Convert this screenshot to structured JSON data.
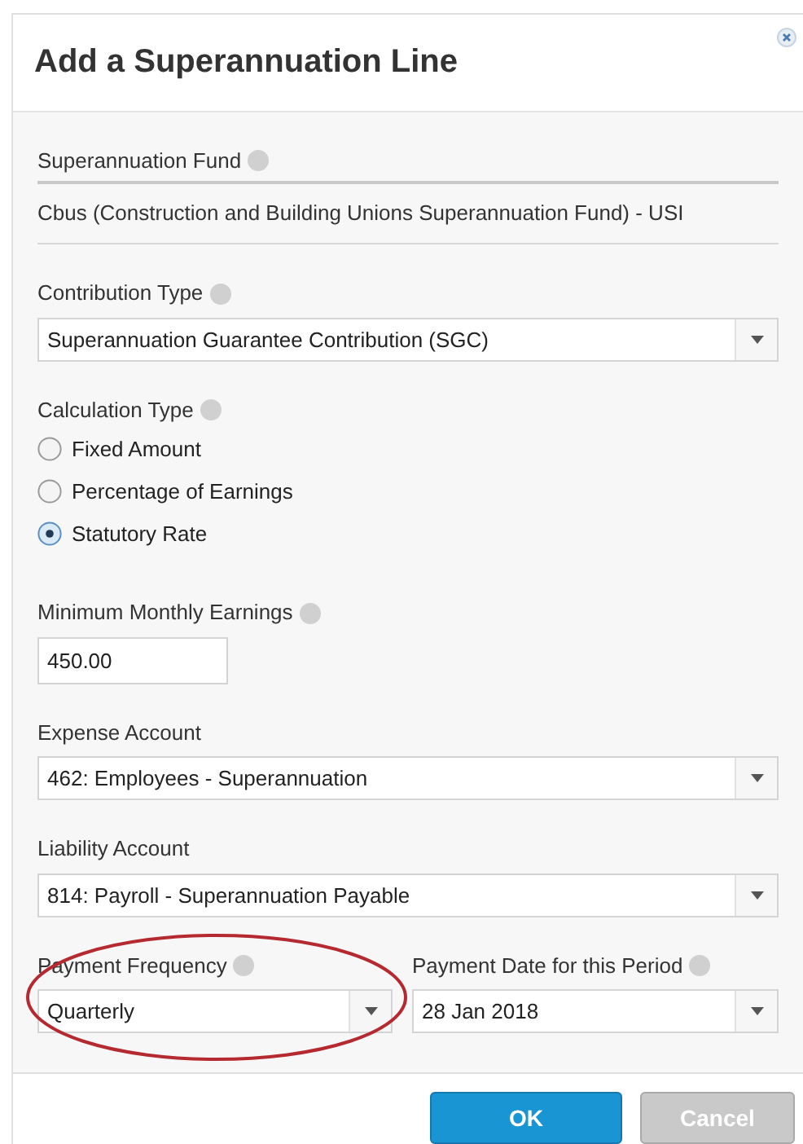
{
  "dialog": {
    "title": "Add a Superannuation Line"
  },
  "fund": {
    "label": "Superannuation Fund",
    "value": "Cbus (Construction and Building Unions Superannuation Fund) - USI"
  },
  "contribution_type": {
    "label": "Contribution Type",
    "value": "Superannuation Guarantee Contribution (SGC)"
  },
  "calculation_type": {
    "label": "Calculation Type",
    "options": [
      {
        "label": "Fixed Amount",
        "selected": false
      },
      {
        "label": "Percentage of Earnings",
        "selected": false
      },
      {
        "label": "Statutory Rate",
        "selected": true
      }
    ]
  },
  "minimum_monthly_earnings": {
    "label": "Minimum Monthly Earnings",
    "value": "450.00"
  },
  "expense_account": {
    "label": "Expense Account",
    "value": "462: Employees - Superannuation"
  },
  "liability_account": {
    "label": "Liability Account",
    "value": "814: Payroll - Superannuation Payable"
  },
  "payment_frequency": {
    "label": "Payment Frequency",
    "value": "Quarterly"
  },
  "payment_date": {
    "label": "Payment Date for this Period",
    "value": "28 Jan 2018"
  },
  "buttons": [
    {
      "label": "OK",
      "kind": "primary"
    },
    {
      "label": "Cancel",
      "kind": "secondary"
    }
  ]
}
